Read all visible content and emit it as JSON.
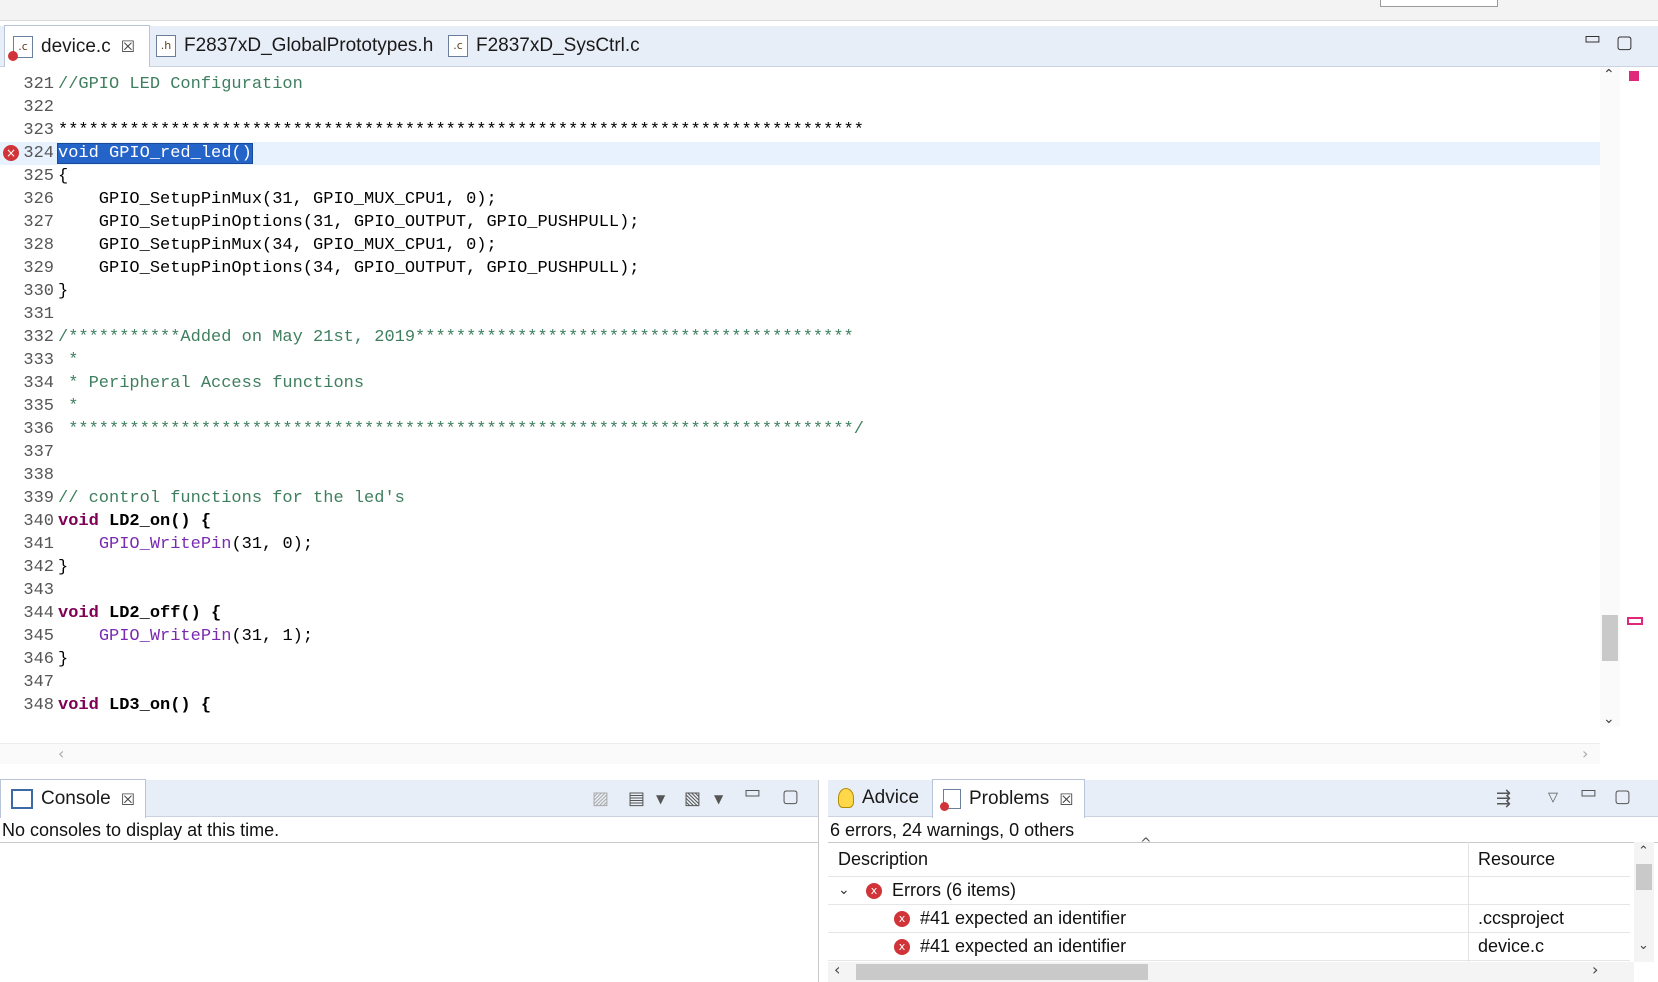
{
  "editor": {
    "tabs": [
      {
        "label": "device.c",
        "icon": "c-source-file-error-icon",
        "active": true,
        "closable": true
      },
      {
        "label": "F2837xD_GlobalPrototypes.h",
        "icon": "h-header-file-icon",
        "active": false
      },
      {
        "label": "F2837xD_SysCtrl.c",
        "icon": "c-source-file-icon",
        "active": false
      }
    ],
    "close_glyph": "☒",
    "minimize_glyph": "▭",
    "maximize_glyph": "▢",
    "error_line": "324",
    "lines": [
      {
        "n": "321",
        "text": "//GPIO LED Configuration",
        "style": "comment"
      },
      {
        "n": "322",
        "text": "",
        "style": "text"
      },
      {
        "n": "323",
        "text": "*******************************************************************************",
        "style": "text"
      },
      {
        "n": "324",
        "text": "void GPIO_red_led()",
        "style": "selected",
        "error": true
      },
      {
        "n": "325",
        "text": "{",
        "style": "text"
      },
      {
        "n": "326",
        "text": "    GPIO_SetupPinMux(31, GPIO_MUX_CPU1, 0);",
        "style": "text"
      },
      {
        "n": "327",
        "text": "    GPIO_SetupPinOptions(31, GPIO_OUTPUT, GPIO_PUSHPULL);",
        "style": "text"
      },
      {
        "n": "328",
        "text": "    GPIO_SetupPinMux(34, GPIO_MUX_CPU1, 0);",
        "style": "text"
      },
      {
        "n": "329",
        "text": "    GPIO_SetupPinOptions(34, GPIO_OUTPUT, GPIO_PUSHPULL);",
        "style": "text"
      },
      {
        "n": "330",
        "text": "}",
        "style": "text"
      },
      {
        "n": "331",
        "text": "",
        "style": "text"
      },
      {
        "n": "332",
        "text": "/***********Added on May 21st, 2019*******************************************",
        "style": "comment"
      },
      {
        "n": "333",
        "text": " *",
        "style": "comment"
      },
      {
        "n": "334",
        "text": " * Peripheral Access functions",
        "style": "comment"
      },
      {
        "n": "335",
        "text": " *",
        "style": "comment"
      },
      {
        "n": "336",
        "text": " *****************************************************************************/",
        "style": "comment"
      },
      {
        "n": "337",
        "text": "",
        "style": "text"
      },
      {
        "n": "338",
        "text": "",
        "style": "text"
      },
      {
        "n": "339",
        "text": "// control functions for the led's",
        "style": "comment"
      },
      {
        "n": "340",
        "kw": "void",
        "text": " LD2_on() {",
        "style": "kwline"
      },
      {
        "n": "341",
        "pre": "    ",
        "call": "GPIO_WritePin",
        "text": "(31, 0);",
        "style": "callline"
      },
      {
        "n": "342",
        "text": "}",
        "style": "text"
      },
      {
        "n": "343",
        "text": "",
        "style": "text"
      },
      {
        "n": "344",
        "kw": "void",
        "text": " LD2_off() {",
        "style": "kwline"
      },
      {
        "n": "345",
        "pre": "    ",
        "call": "GPIO_WritePin",
        "text": "(31, 1);",
        "style": "callline"
      },
      {
        "n": "346",
        "text": "}",
        "style": "text"
      },
      {
        "n": "347",
        "text": "",
        "style": "text"
      },
      {
        "n": "348",
        "kw": "void",
        "text": " LD3_on() {",
        "style": "kwline"
      }
    ]
  },
  "console": {
    "tab_label": "Console",
    "tab_icon": "console-icon",
    "message": "No consoles to display at this time."
  },
  "problems": {
    "advice_label": "Advice",
    "tab_label": "Problems",
    "summary": "6 errors, 24 warnings, 0 others",
    "col_description": "Description",
    "col_resource": "Resource",
    "group_label": "Errors (6 items)",
    "rows": [
      {
        "description": "#41 expected an identifier",
        "resource": ".ccsproject"
      },
      {
        "description": "#41 expected an identifier",
        "resource": "device.c"
      }
    ]
  },
  "colors": {
    "comment": "#3f7f5f",
    "keyword": "#7f0055",
    "call": "#7a2ab0",
    "selection": "#2463c7",
    "current_line": "#e8f2fe",
    "error": "#d13438",
    "overview_marker": "#e0287a"
  }
}
